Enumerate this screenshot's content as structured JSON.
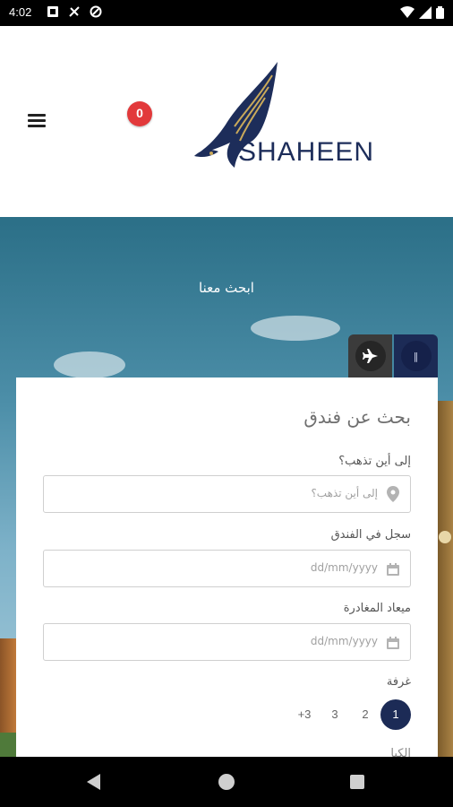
{
  "status_bar": {
    "time": "4:02",
    "left_icons": [
      "sim-card-icon",
      "no-internet-icon",
      "data-saver-icon"
    ],
    "right_icons": [
      "wifi-icon",
      "signal-icon",
      "battery-icon"
    ]
  },
  "header": {
    "brand": "SHAHEEN",
    "cart_count": "0",
    "menu_icon": "hamburger-menu-icon",
    "brand_color": "#1d2d5a"
  },
  "hero": {
    "title": "ابحث معنا"
  },
  "tabs": [
    {
      "icon": "airplane-icon",
      "active": false
    },
    {
      "icon": "hotel-icon",
      "label": "‖",
      "active": true
    }
  ],
  "search_form": {
    "title": "بحث عن فندق",
    "destination": {
      "label": "إلى أين تذهب؟",
      "placeholder": "إلى أين تذهب؟",
      "icon": "location-pin-icon"
    },
    "check_in": {
      "label": "سجل في الفندق",
      "placeholder": "dd/mm/yyyy",
      "icon": "calendar-icon"
    },
    "check_out": {
      "label": "ميعاد المغادرة",
      "placeholder": "dd/mm/yyyy",
      "icon": "calendar-icon"
    },
    "rooms": {
      "label": "غرفة",
      "options": [
        "1",
        "2",
        "3",
        "+3"
      ],
      "selected": "1"
    },
    "next_label_partial": "الكبا"
  },
  "colors": {
    "primary_navy": "#1c2b56",
    "cart_red": "#e2393b"
  }
}
